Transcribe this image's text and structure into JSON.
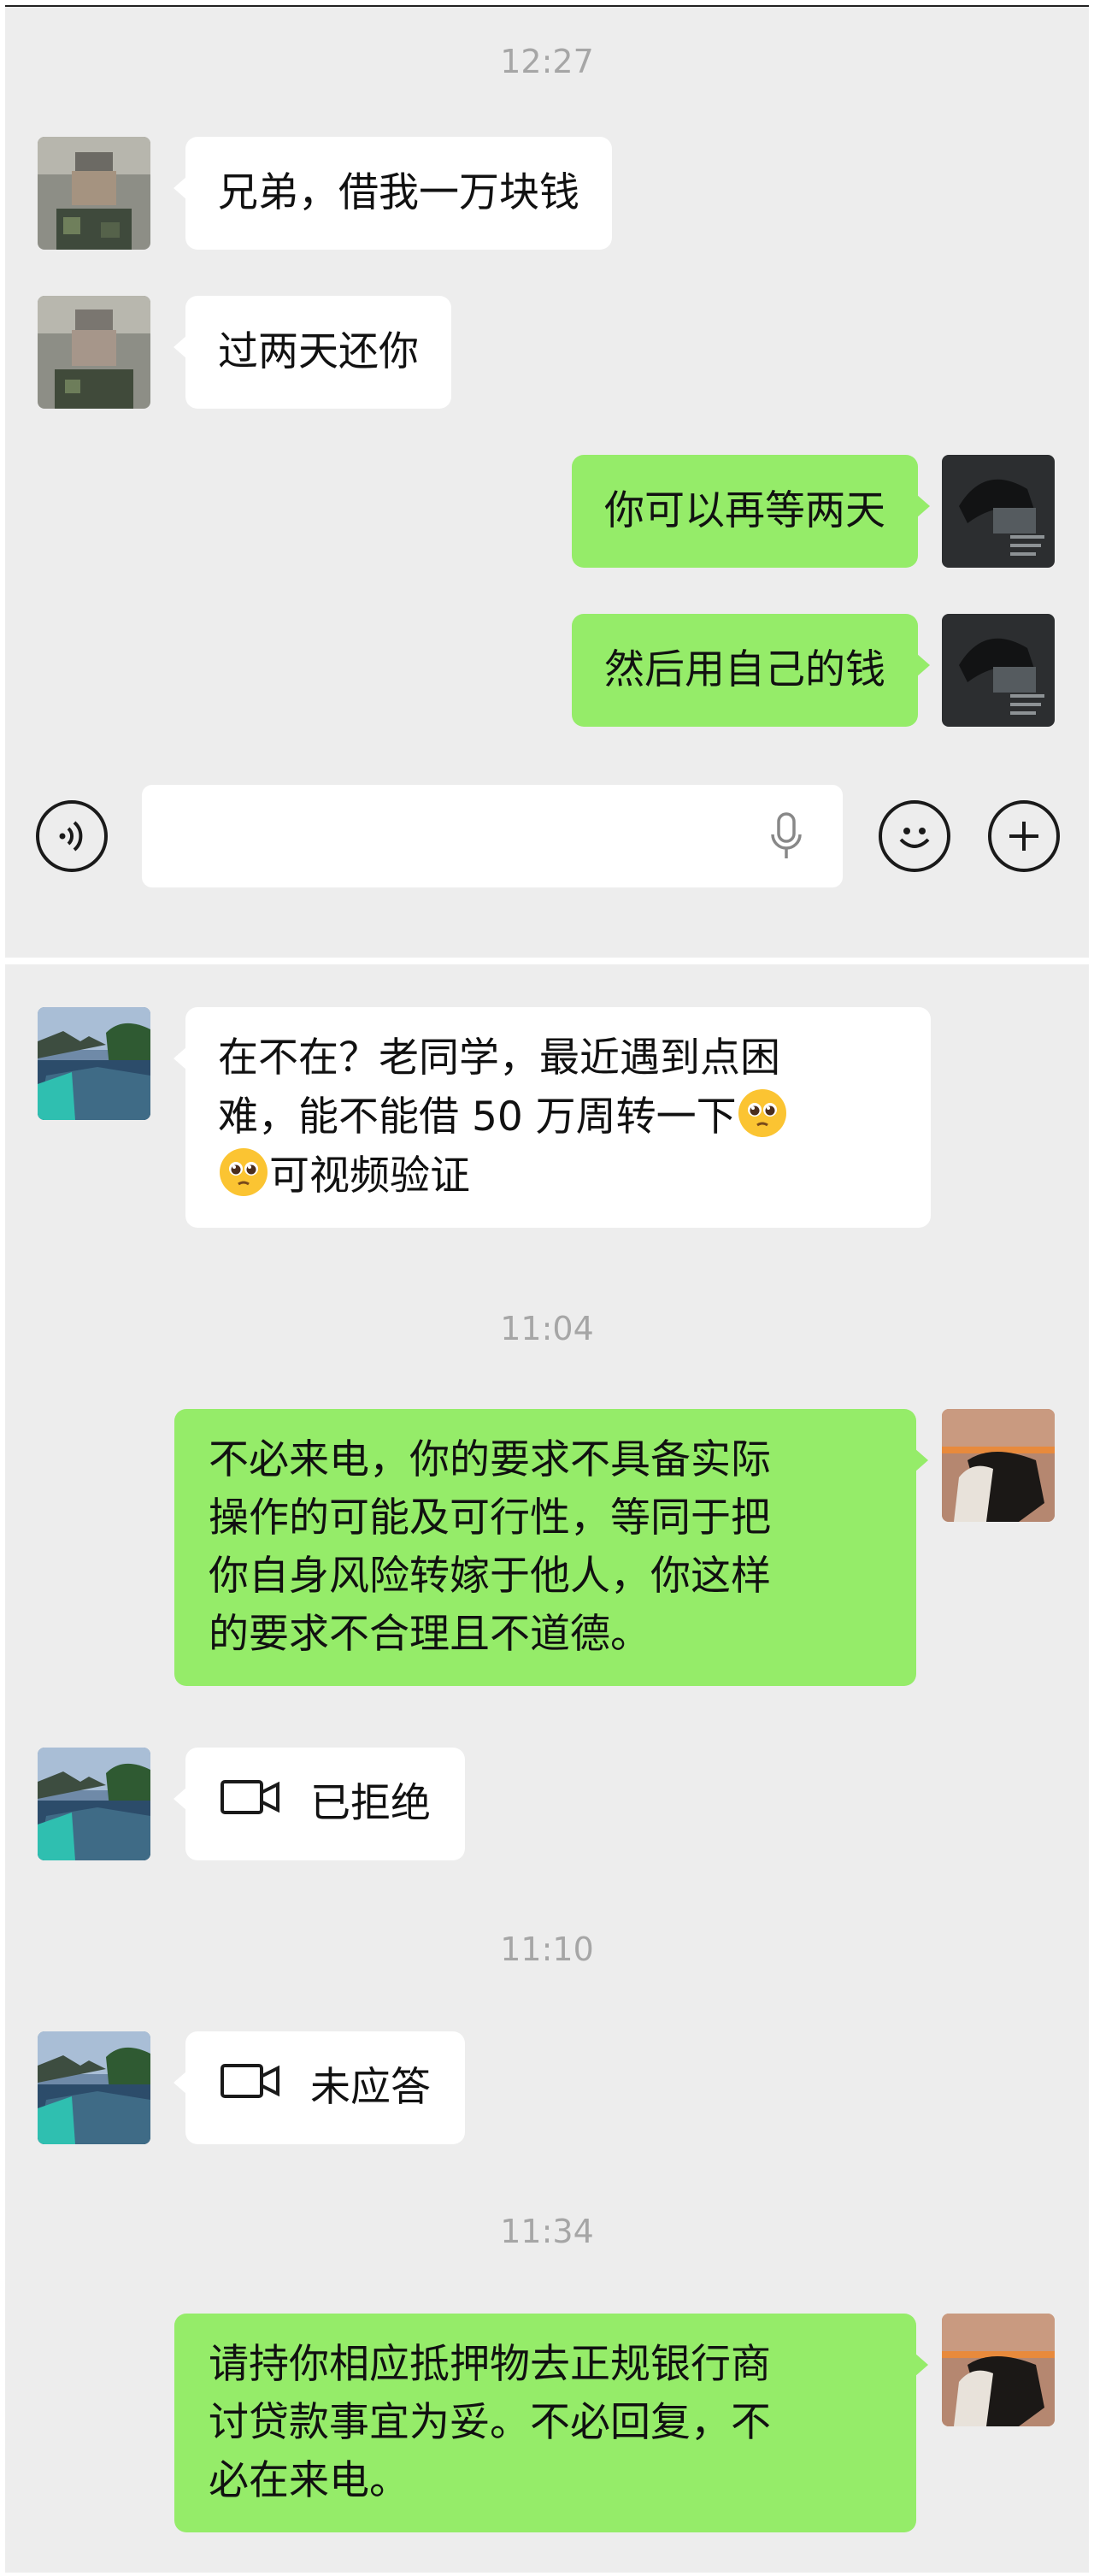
{
  "panel_top": {
    "timestamp": "12:27",
    "messages": [
      {
        "side": "left",
        "text": "兄弟，借我一万块钱"
      },
      {
        "side": "left",
        "text": "过两天还你"
      },
      {
        "side": "right",
        "text": "你可以再等两天"
      },
      {
        "side": "right",
        "text": "然后用自己的钱"
      }
    ],
    "input_bar": {
      "voice_icon": "voice-icon",
      "mic_icon": "microphone-icon",
      "emoji_icon": "emoji-icon",
      "plus_icon": "plus-icon",
      "input_value": ""
    }
  },
  "panel_bottom": {
    "msg1_line1": "在不在？老同学，最近遇到点困",
    "msg1_line2": "难，能不能借 50 万周转一下",
    "msg1_line3": "可视频验证",
    "timestamp1": "11:04",
    "msg2": [
      "不必来电，你的要求不具备实际",
      "操作的可能及可行性，等同于把",
      "你自身风险转嫁于他人，你这样",
      "的要求不合理且不道德。"
    ],
    "call1": "已拒绝",
    "timestamp2": "11:10",
    "call2": "未应答",
    "timestamp3": "11:34",
    "msg3": [
      "请持你相应抵押物去正规银行商",
      "讨贷款事宜为妥。不必回复，不",
      "必在来电。"
    ]
  },
  "colors": {
    "chat_bg": "#ededed",
    "bubble_self": "#95ec69",
    "bubble_other": "#ffffff",
    "timestamp": "#a6a6a6"
  }
}
